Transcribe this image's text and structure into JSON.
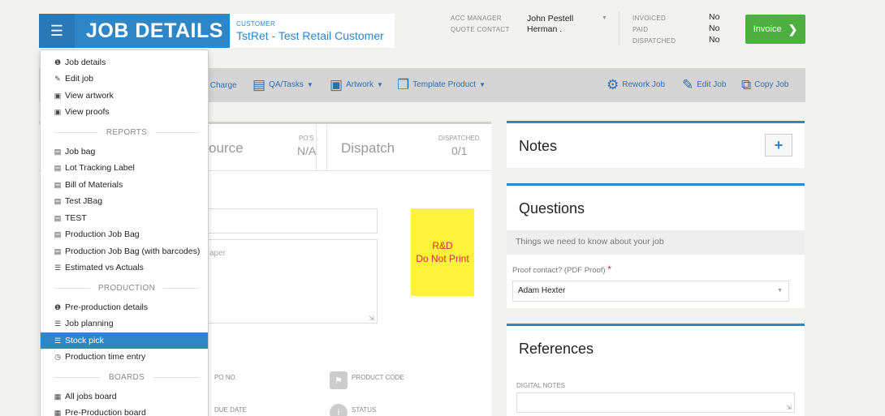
{
  "header": {
    "title": "JOB DETAILS",
    "customer_label": "CUSTOMER",
    "customer_name": "TstRet - Test Retail Customer",
    "acc_manager_label": "ACC MANAGER",
    "acc_manager_value": "John Pestell",
    "quote_contact_label": "QUOTE CONTACT",
    "quote_contact_value": "Herman .",
    "invoiced_label": "INVOICED",
    "invoiced_value": "No",
    "paid_label": "PAID",
    "paid_value": "No",
    "dispatched_label": "DISPATCHED",
    "dispatched_value": "No",
    "invoice_button": "Invoice"
  },
  "toolbar": {
    "charge_label": "c Charge",
    "qa_tasks": "QA/Tasks",
    "artwork": "Artwork",
    "template_product": "Template Product",
    "rework_job": "Rework Job",
    "edit_job": "Edit Job",
    "copy_job": "Copy Job"
  },
  "main": {
    "source_label": "ource",
    "pos_label": "PO'S",
    "pos_value": "N/A",
    "dispatch_label": "Dispatch",
    "dispatched_label": "DISPATCHED",
    "dispatched_value": "0/1",
    "textarea_placeholder": "aper",
    "sticky_line1": "R&D",
    "sticky_line2": "Do Not Print",
    "po_no_label": "PO NO.",
    "product_code_label": "PRODUCT CODE",
    "due_date_label": "DUE DATE",
    "status_label": "STATUS"
  },
  "notes": {
    "title": "Notes",
    "add_label": "+"
  },
  "questions": {
    "title": "Questions",
    "subtitle": "Things we need to know about your job",
    "proof_label": "Proof contact? (PDF Proof)",
    "required_mark": "*",
    "proof_value": "Adam Hexter"
  },
  "references": {
    "title": "References",
    "digital_notes_label": "DIGITAL NOTES"
  },
  "menu": {
    "items_top": [
      "Job details",
      "Edit job",
      "View artwork",
      "View proofs"
    ],
    "reports_label": "REPORTS",
    "reports": [
      "Job bag",
      "Lot Tracking Label",
      "Bill of Materials",
      "Test JBag",
      "TEST",
      "Production Job Bag",
      "Production Job Bag (with barcodes)",
      "Estimated vs Actuals"
    ],
    "production_label": "PRODUCTION",
    "production": [
      "Pre-production details",
      "Job planning",
      "Stock pick",
      "Production time entry"
    ],
    "boards_label": "BOARDS",
    "boards": [
      "All jobs board",
      "Pre-Production board"
    ],
    "active_item": "Stock pick"
  }
}
